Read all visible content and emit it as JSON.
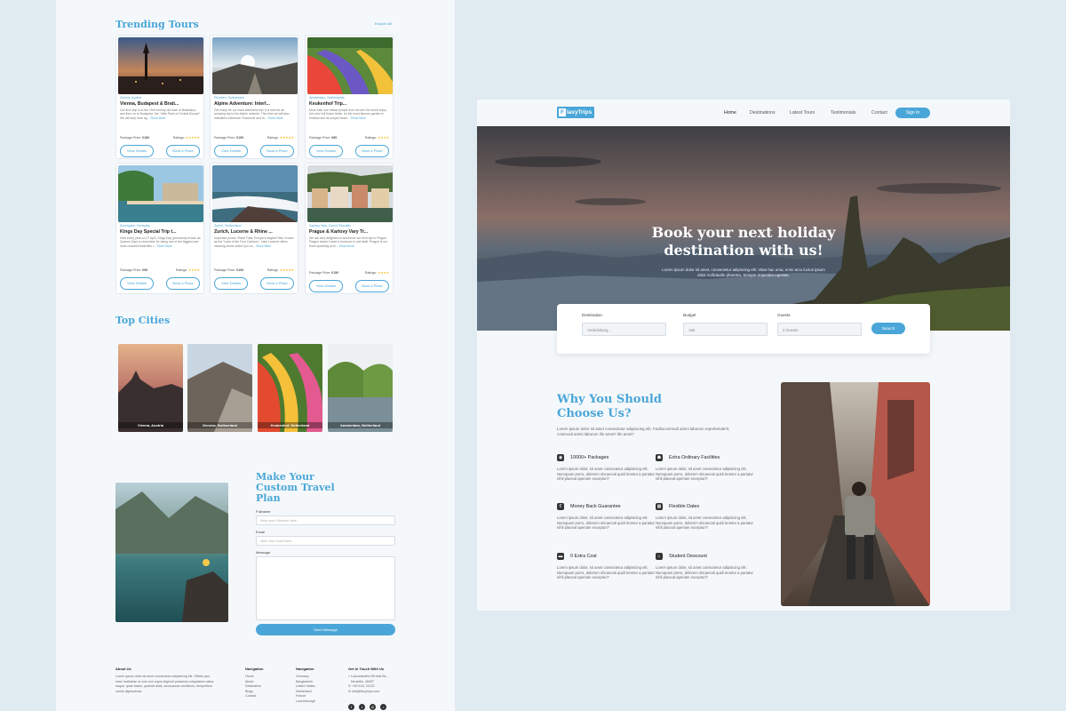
{
  "left_page": {
    "trending": {
      "title": "Trending Tours",
      "explore": "Explore All",
      "price_label": "Package Price:",
      "rating_label": "Ratings:",
      "view_label": "View Details",
      "book_label": "Book a Place",
      "read_more": "Show More",
      "cards": [
        {
          "loc": "Vienna, Austria",
          "title": "Vienna, Budapest & Brati...",
          "desc": "Our first stop is in the 19th century old town of Bratislava, and then on to Budapest, the \"Little Paris of Central Europe\". We will stop here ng...",
          "price": "€180",
          "stars": "★★★★★"
        },
        {
          "loc": "Pfronten, Switzerland",
          "title": "Alpine Adventure: Interl...",
          "desc": "Get ready for our most awesome trip! It is best for an amazing trip to the Alpine network. This time we will also Interlaken extensive Chamonix and th...",
          "price": "€199",
          "stars": "★★★★★"
        },
        {
          "loc": "Amsterdam, Netherlands",
          "title": "Keukenhof Trip...",
          "desc": "More than one million people from all over the world enjoy the color full flower fields. As the most famous garden in Holland and its unique beaut...",
          "price": "€85",
          "stars": "★★★★"
        },
        {
          "loc": "Koenigsee, Germany",
          "title": "Kings Day Special Trip t...",
          "desc": "Held every year on 27 April, Kings Day (previously known as Queens Day) is remember for being one of the biggest and most colourful festivities i...",
          "price": "€95",
          "stars": "★★★★"
        },
        {
          "loc": "Zurich, Switzerland",
          "title": "Zurich, Lucerne & Rhine ...",
          "desc": "Important points: Rhine Falls, Europe's largest Falls. Known as the \"Lake of the Four Cantons\", Lake Lucerne offers stunning views where you ca...",
          "price": "€165",
          "stars": "★★★★★"
        },
        {
          "loc": "Karlovy Vary, Czech Republic",
          "title": "Prague & Karlovy Vary Tr...",
          "desc": "We are very delighted to announce our next trip to Prague. Prague doesn't need a brochure to sell itself. Prague is our three sparkling at th...",
          "price": "€150",
          "stars": "★★★★"
        }
      ]
    },
    "cities": {
      "title": "Top Cities",
      "items": [
        "Vienna, Austria",
        "Geneva, Switzerland",
        "Keukenhof, Netherland",
        "Amsterdam, Netherland"
      ]
    },
    "plan": {
      "title": "Make Your Custom Travel Plan",
      "fullname_label": "Fullname",
      "fullname_ph": "Write your Fullname Here",
      "email_label": "Email",
      "email_ph": "Write Your Email Here",
      "message_label": "Message",
      "send": "Send Message"
    },
    "footer": {
      "about_h": "About Us",
      "about_t": "Lorem ipsum dolor sit amet consectetur adipisicing elit. Officiis quo esse molestiae ut cum non culpa eligendi possimus voluptatum natus eaque, quae totam, quaerat alias, accusamus architecto, temporibus omnis dignissimos.",
      "nav_h": "Navigation",
      "nav_items": [
        "Home",
        "About",
        "Destination",
        "Blogs",
        "Contact"
      ],
      "nav2_h": "Navigation",
      "nav2_items": [
        "Germany",
        "Bangladesh",
        "United States",
        "Netherland",
        "France",
        "Luxembourgh"
      ],
      "touch_h": "Get In Touch With Us",
      "touch_items": [
        "Lutzowstraße 56 best Be...",
        "Neukölln, 28497",
        "+49 0111 22222",
        "info@flaxytrips.com"
      ]
    }
  },
  "right_page": {
    "logo_letter": "F",
    "logo_text": "laxyTrips",
    "nav": [
      "Home",
      "Destinations",
      "Latest Tours",
      "Testimonials",
      "Contact"
    ],
    "signin": "Sign In",
    "hero_title": "Book your next holiday destination with us!",
    "hero_sub": "Lorem ipsum dolor sit amet, consectetur adipiscing elit. Vitae hac urna, enim arcu luctus ipsum dolor sollicitudin pharetra. Semper imperdiet egestas.",
    "search": {
      "destination_label": "Destination",
      "destination_value": "Ambolsburg...",
      "budget_label": "Budget",
      "budget_value": "150",
      "guests_label": "Guests",
      "guests_value": "2 Guests",
      "button": "Search"
    },
    "why": {
      "title": "Why You Should Choose Us?",
      "sub": "Lorem ipsum dolor sit amet consectetur adipisicing elit. Facilisconmodi animi laborum reprehenderit, commodi animi laborum illo amet? Illo amet?",
      "feature_text": "Lorem ipsum dolor, sit amet consectetur adipisicing elit. Numquam porro, dolorem obcaecati quidi tenetur a pariatur nihil placeat aperiam excepturi?",
      "features": [
        {
          "title": "10000+ Packages",
          "icon": "globe-icon",
          "glyph": "◉"
        },
        {
          "title": "Extra Ordinary Facilities",
          "icon": "hiker-icon",
          "glyph": "☗"
        },
        {
          "title": "Money Back Guarantee",
          "icon": "money-icon",
          "glyph": "€"
        },
        {
          "title": "Flexible Dates",
          "icon": "calendar-icon",
          "glyph": "▦"
        },
        {
          "title": "0 Extra Cost",
          "icon": "wallet-icon",
          "glyph": "▬"
        },
        {
          "title": "Student Descount",
          "icon": "bank-icon",
          "glyph": "⌂"
        }
      ]
    }
  }
}
